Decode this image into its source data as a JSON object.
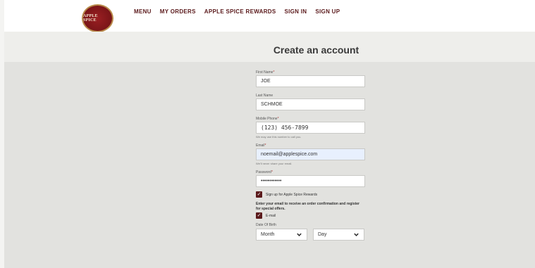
{
  "logo": {
    "text": "APPLE SPICE"
  },
  "nav": {
    "links": [
      "MENU",
      "MY ORDERS",
      "APPLE SPICE REWARDS",
      "SIGN IN",
      "SIGN UP"
    ]
  },
  "page": {
    "title": "Create an account"
  },
  "form": {
    "first_name": {
      "label": "First Name",
      "required": "*",
      "value": "JOE"
    },
    "last_name": {
      "label": "Last Name",
      "value": "SCHMOE"
    },
    "mobile_phone": {
      "label": "Mobile Phone",
      "required": "*",
      "value": "(123) 456-7899",
      "hint": "We may use this number to call you."
    },
    "email": {
      "label": "Email",
      "required": "*",
      "value": "noemail@applespice.com",
      "hint": "We'll never share your email."
    },
    "password": {
      "label": "Password",
      "required": "*",
      "value": "••••••••••••"
    },
    "rewards_checkbox": {
      "label": "Sign up for Apple Spice Rewards",
      "checked": true
    },
    "offer_text": "Enter your email to receive an order confirmation and register for special offers.",
    "email_checkbox": {
      "label": "E-mail",
      "checked": true
    },
    "dob": {
      "label": "Date Of Birth",
      "month": "Month",
      "day": "Day"
    }
  },
  "colors": {
    "brand": "#5b1a1c",
    "logo_red": "#7a1518"
  }
}
